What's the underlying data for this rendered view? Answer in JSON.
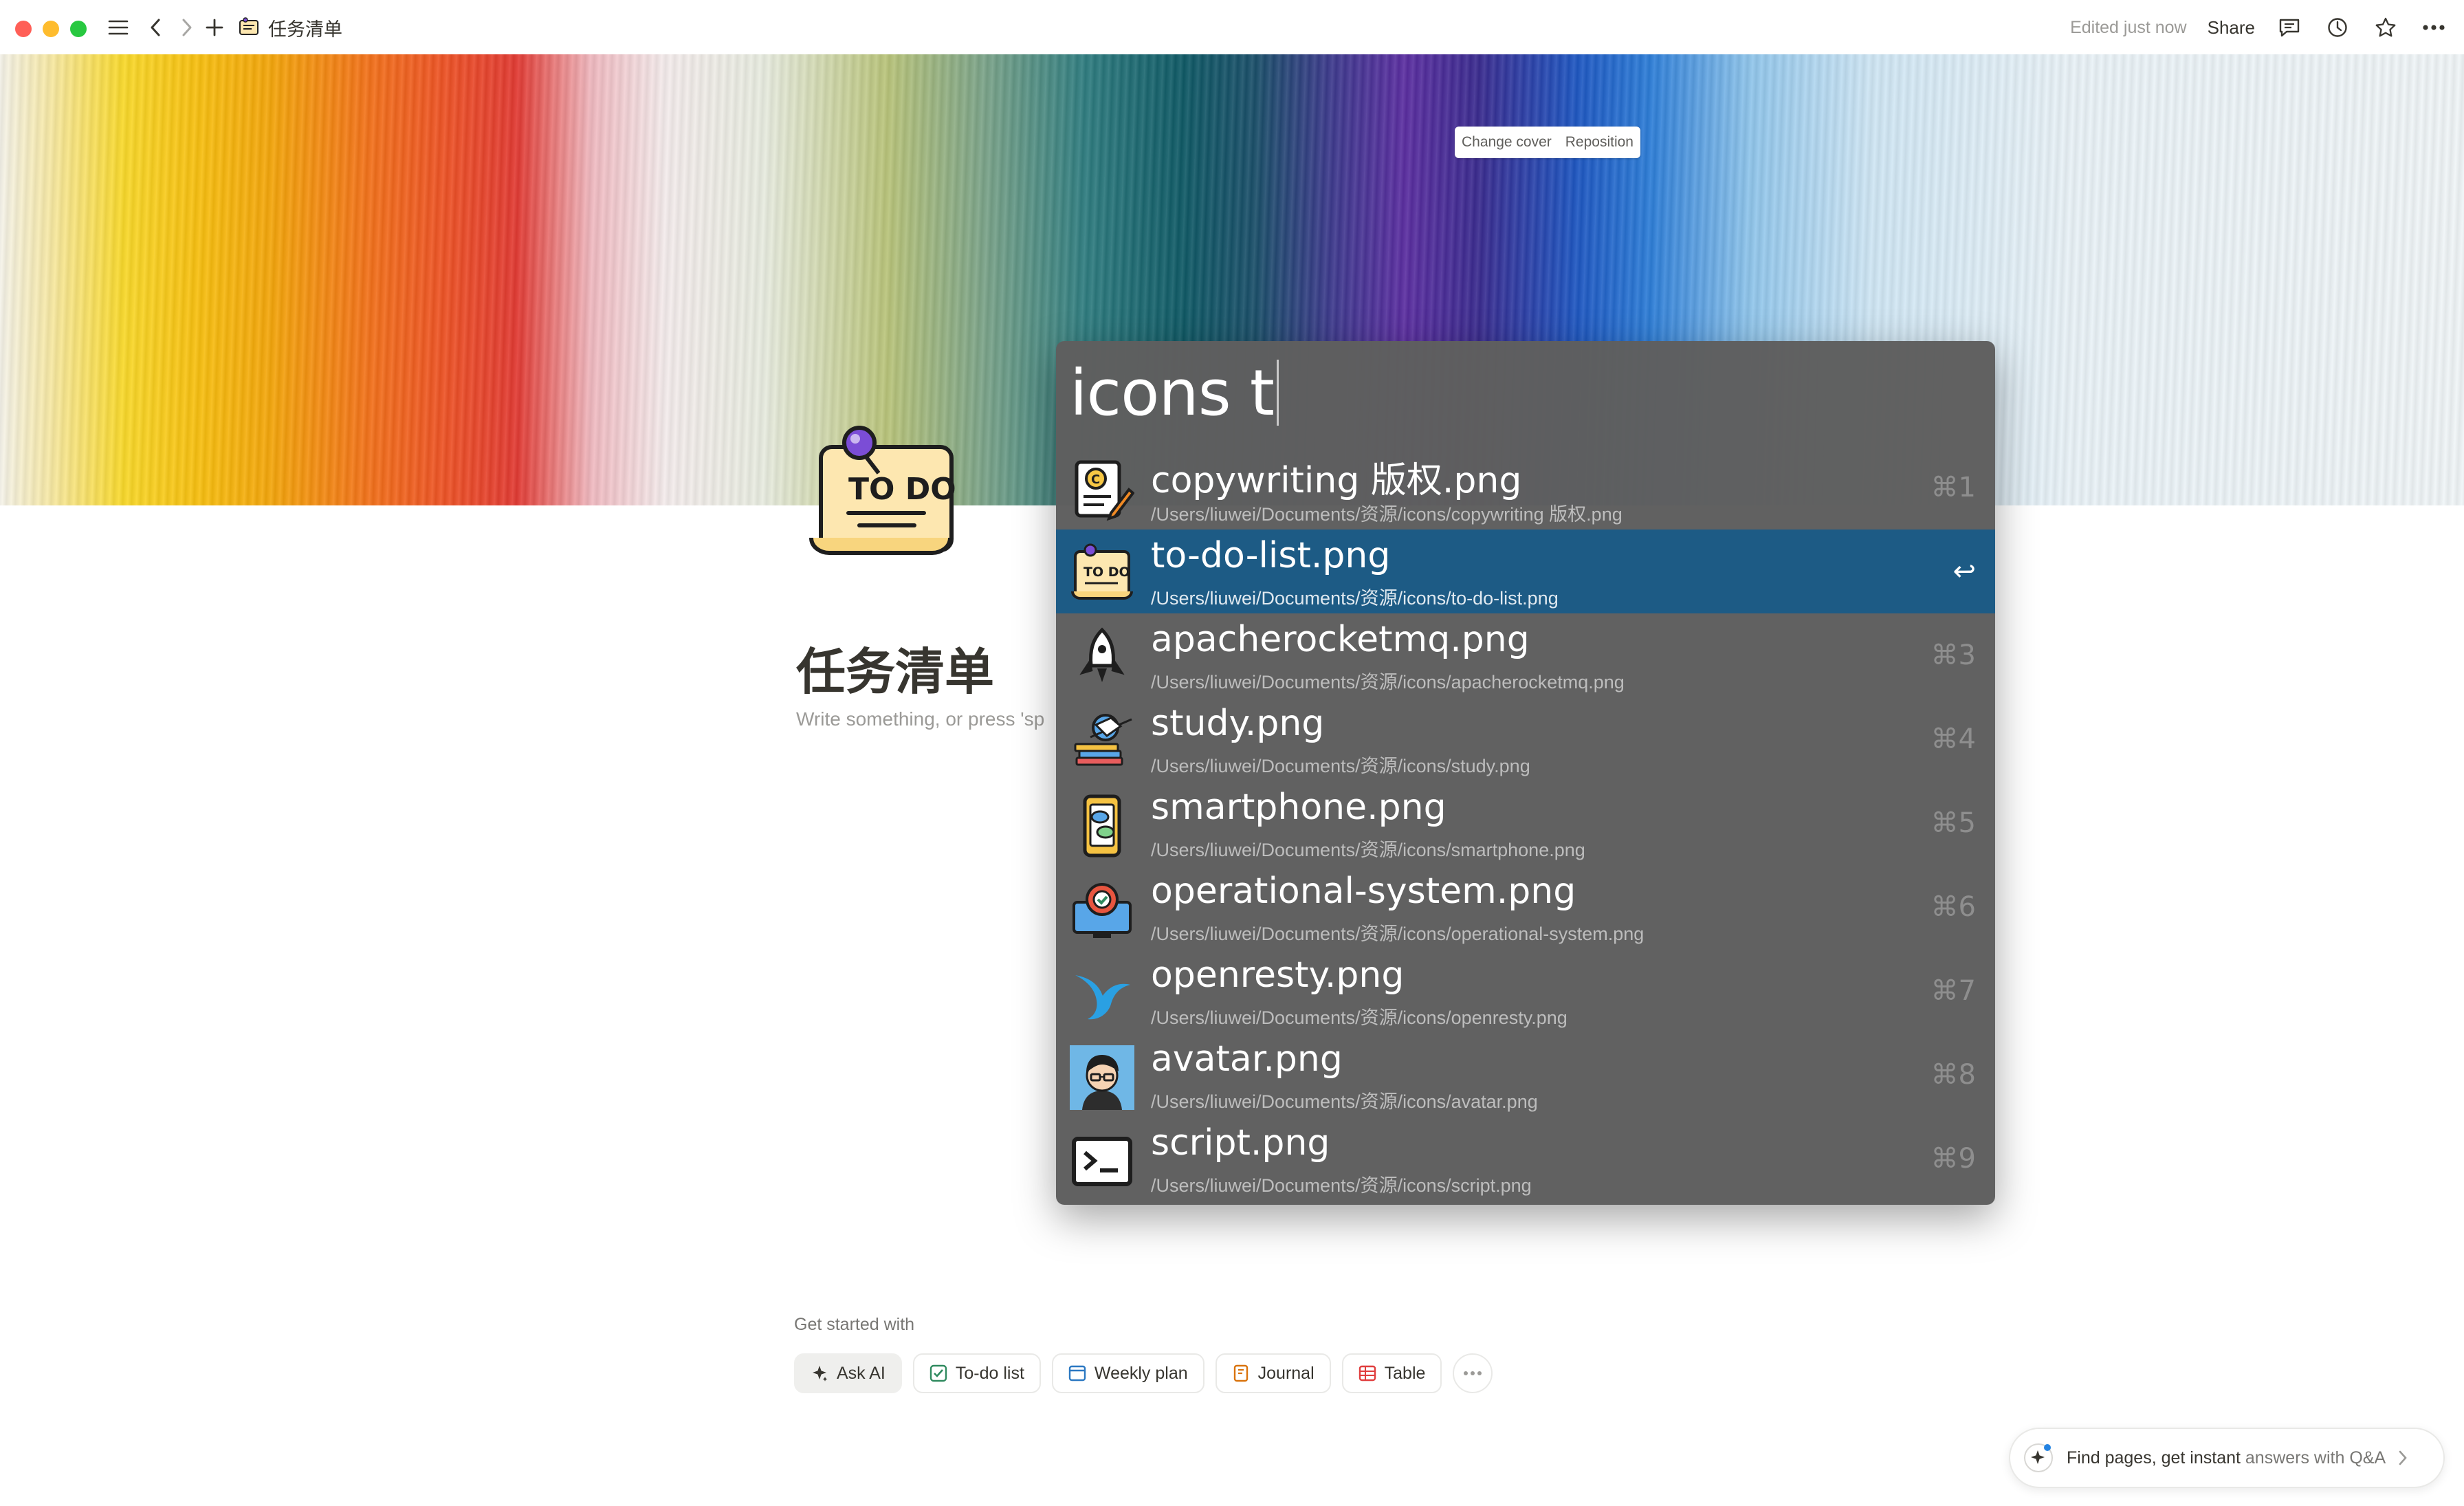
{
  "titlebar": {
    "page_name": "任务清单",
    "edited": "Edited just now",
    "share": "Share"
  },
  "cover": {
    "change_cover": "Change cover",
    "reposition": "Reposition"
  },
  "page": {
    "icon": "todo-note-icon",
    "title": "任务清单",
    "placeholder": "Write something, or press 'sp"
  },
  "launcher": {
    "query": "icons t",
    "results": [
      {
        "name": "copywriting 版权.png",
        "path": "/Users/liuwei/Documents/资源/icons/copywriting 版权.png",
        "shortcut": "⌘1",
        "icon": "copywriting-icon",
        "selected": false
      },
      {
        "name": "to-do-list.png",
        "path": "/Users/liuwei/Documents/资源/icons/to-do-list.png",
        "shortcut": "↩",
        "icon": "todo-list-icon",
        "selected": true
      },
      {
        "name": "apacherocketmq.png",
        "path": "/Users/liuwei/Documents/资源/icons/apacherocketmq.png",
        "shortcut": "⌘3",
        "icon": "rocket-icon",
        "selected": false
      },
      {
        "name": "study.png",
        "path": "/Users/liuwei/Documents/资源/icons/study.png",
        "shortcut": "⌘4",
        "icon": "study-icon",
        "selected": false
      },
      {
        "name": "smartphone.png",
        "path": "/Users/liuwei/Documents/资源/icons/smartphone.png",
        "shortcut": "⌘5",
        "icon": "smartphone-icon",
        "selected": false
      },
      {
        "name": "operational-system.png",
        "path": "/Users/liuwei/Documents/资源/icons/operational-system.png",
        "shortcut": "⌘6",
        "icon": "operational-system-icon",
        "selected": false
      },
      {
        "name": "openresty.png",
        "path": "/Users/liuwei/Documents/资源/icons/openresty.png",
        "shortcut": "⌘7",
        "icon": "openresty-icon",
        "selected": false
      },
      {
        "name": "avatar.png",
        "path": "/Users/liuwei/Documents/资源/icons/avatar.png",
        "shortcut": "⌘8",
        "icon": "avatar-icon",
        "selected": false
      },
      {
        "name": "script.png",
        "path": "/Users/liuwei/Documents/资源/icons/script.png",
        "shortcut": "⌘9",
        "icon": "script-icon",
        "selected": false
      }
    ]
  },
  "get_started": {
    "label": "Get started with",
    "chips": [
      "Ask AI",
      "To-do list",
      "Weekly plan",
      "Journal",
      "Table"
    ]
  },
  "qa": {
    "text_bold": "Find pages, get instant",
    "text_muted": " answers with Q&A"
  },
  "colors": {
    "selected_row": "#1d5b85",
    "launcher_bg": "#5e5e5e",
    "traffic_red": "#ff5f57",
    "traffic_yellow": "#febc2e",
    "traffic_green": "#28c840"
  }
}
